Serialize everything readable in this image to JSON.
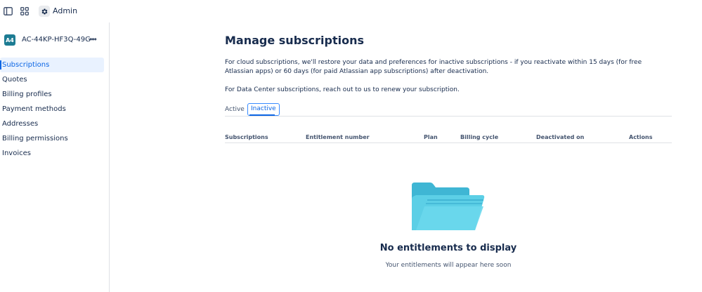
{
  "topbar": {
    "title": "Admin",
    "icons": [
      "sidebar-toggle-icon",
      "app-switcher-icon",
      "gear-icon"
    ]
  },
  "sidebar": {
    "account": {
      "avatar": "A4",
      "name": "AC-44KP-HF3Q-49G",
      "more": "•••"
    },
    "items": [
      {
        "label": "Subscriptions",
        "active": true
      },
      {
        "label": "Quotes"
      },
      {
        "label": "Billing profiles"
      },
      {
        "label": "Payment methods"
      },
      {
        "label": "Addresses"
      },
      {
        "label": "Billing permissions"
      },
      {
        "label": "Invoices"
      }
    ]
  },
  "main": {
    "title": "Manage subscriptions",
    "paragraph1": "For cloud subscriptions, we'll restore your data and preferences for inactive subscriptions - if you reactivate within 15 days (for free Atlassian apps) or 60 days (for paid Atlassian app subscriptions) after deactivation.",
    "paragraph2": "For Data Center subscriptions, reach out to us to renew your subscription.",
    "tabs": [
      {
        "label": "Active"
      },
      {
        "label": "Inactive",
        "selected": true
      }
    ],
    "table": {
      "columns": [
        "Subscriptions",
        "Entitlement number",
        "Plan",
        "Billing cycle",
        "Deactivated on",
        "Actions"
      ],
      "rows": []
    },
    "empty_state": {
      "icon": "folder-icon",
      "title": "No entitlements to display",
      "subtitle": "Your entitlements will appear here soon"
    }
  },
  "colors": {
    "accent": "#0c66e4",
    "active_bg": "#e9f2ff",
    "folder": "#4fc3dd",
    "avatar": "#1d7c93"
  }
}
